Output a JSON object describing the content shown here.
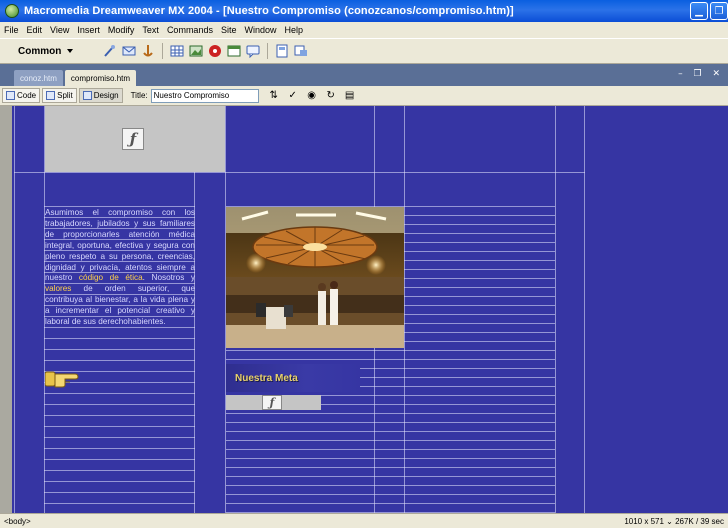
{
  "window": {
    "title": "Macromedia Dreamweaver MX 2004 - [Nuestro Compromiso (conozcanos/compromiso.htm)]"
  },
  "menu": [
    "File",
    "Edit",
    "View",
    "Insert",
    "Modify",
    "Text",
    "Commands",
    "Site",
    "Window",
    "Help"
  ],
  "insert_bar": {
    "category": "Common",
    "icons": [
      "hyperlink-icon",
      "email-link-icon",
      "named-anchor-icon",
      "table-icon",
      "image-icon",
      "media-icon",
      "date-icon",
      "comment-icon",
      "template-icon",
      "tag-chooser-icon"
    ]
  },
  "tabs": [
    {
      "label": "conoz.htm",
      "active": false
    },
    {
      "label": "compromiso.htm",
      "active": true
    }
  ],
  "doc_toolbar": {
    "code_label": "Code",
    "split_label": "Split",
    "design_label": "Design",
    "title_label": "Title:",
    "title_value": "Nuestro Compromiso"
  },
  "content": {
    "paragraph_1": "Asumimos el compromiso con los trabajadores, jubilados y sus familiares de proporcionarles atención médica integral, oportuna, efectiva y segura con pleno respeto a su persona, creencias, dignidad y privacía, atentos siempre a nuestro",
    "highlight_1": "código de ética",
    "paragraph_2": ". Nosotros y",
    "highlight_2": "valores",
    "paragraph_3": "de orden superior, que contribuya al bienestar, a la vida plena y a incrementar el potencial creativo y laboral de sus derechohabientes.",
    "meta_heading": "Nuestra Meta"
  },
  "status": {
    "tag": "<body>",
    "info": "1010 x 571 ⌄ 267K / 39 sec"
  },
  "colors": {
    "page_background": "#3635a3",
    "highlight": "#ffd24a",
    "text": "#d9d9ff"
  }
}
